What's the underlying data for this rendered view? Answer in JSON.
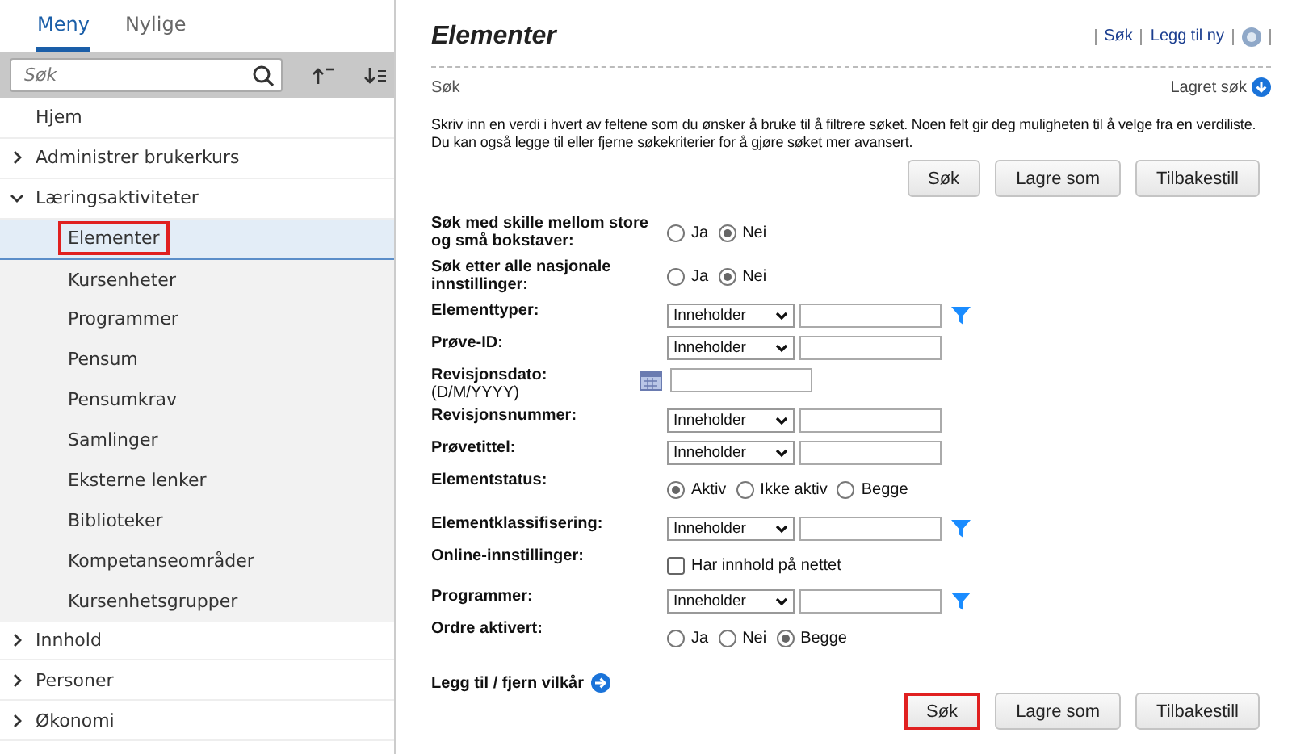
{
  "sidebar": {
    "tabs": [
      {
        "label": "Meny",
        "selected": true
      },
      {
        "label": "Nylige",
        "selected": false
      }
    ],
    "search": {
      "placeholder": "Søk"
    },
    "items": [
      {
        "label": "Hjem",
        "selected": false,
        "marked": false
      },
      {
        "label": "Administrer brukerkurs",
        "expanded": false,
        "selected": false,
        "marked": false
      },
      {
        "label": "Læringsaktiviteter",
        "expanded": true,
        "selected": false,
        "marked": false,
        "children": [
          {
            "label": "Elementer",
            "selected": true,
            "marked": true
          },
          {
            "label": "Kursenheter",
            "selected": false,
            "marked": false
          },
          {
            "label": "Programmer",
            "selected": false,
            "marked": false
          },
          {
            "label": "Pensum",
            "selected": false,
            "marked": false
          },
          {
            "label": "Pensumkrav",
            "selected": false,
            "marked": false
          },
          {
            "label": "Samlinger",
            "selected": false,
            "marked": false
          },
          {
            "label": "Eksterne lenker",
            "selected": false,
            "marked": false
          },
          {
            "label": "Biblioteker",
            "selected": false,
            "marked": false
          },
          {
            "label": "Kompetanseområder",
            "selected": false,
            "marked": false
          },
          {
            "label": "Kursenhetsgrupper",
            "selected": false,
            "marked": false
          }
        ]
      },
      {
        "label": "Innhold",
        "expanded": false,
        "selected": false,
        "marked": false
      },
      {
        "label": "Personer",
        "expanded": false,
        "selected": false,
        "marked": false
      },
      {
        "label": "Økonomi",
        "expanded": false,
        "selected": false,
        "marked": false
      }
    ]
  },
  "main": {
    "title": "Elementer",
    "header_links": [
      "Søk",
      "Legg til ny"
    ],
    "section_label": "Søk",
    "saved_search": "Lagret søk",
    "instructions": [
      "Skriv inn en verdi i hvert av feltene som du ønsker å bruke til å filtrere søket. Noen felt gir deg muligheten til å velge fra en verdiliste.",
      "Du kan også legge til eller fjerne søkekriterier for å gjøre søket mer avansert."
    ],
    "top_buttons": [
      {
        "label": "Søk",
        "marked": false
      },
      {
        "label": "Lagre som",
        "marked": false
      },
      {
        "label": "Tilbakestill",
        "marked": false
      }
    ],
    "fields": [
      {
        "kind": "radio",
        "label": "Søk med skille mellom store og små bokstaver:",
        "options": [
          {
            "label": "Ja",
            "selected": false
          },
          {
            "label": "Nei",
            "selected": true
          }
        ]
      },
      {
        "kind": "radio",
        "label": "Søk etter alle nasjonale innstillinger:",
        "options": [
          {
            "label": "Ja",
            "selected": false
          },
          {
            "label": "Nei",
            "selected": true
          }
        ]
      },
      {
        "kind": "select",
        "label": "Elementtyper:",
        "operator": "Inneholder",
        "filter": true
      },
      {
        "kind": "select",
        "label": "Prøve-ID:",
        "operator": "Inneholder",
        "filter": false
      },
      {
        "kind": "date",
        "label": "Revisjonsdato:",
        "hint": "(D/M/YYYY)"
      },
      {
        "kind": "select",
        "label": "Revisjonsnummer:",
        "operator": "Inneholder",
        "filter": false
      },
      {
        "kind": "select",
        "label": "Prøvetittel:",
        "operator": "Inneholder",
        "filter": false
      },
      {
        "kind": "radio",
        "label": "Elementstatus:",
        "options": [
          {
            "label": "Aktiv",
            "selected": true
          },
          {
            "label": "Ikke aktiv",
            "selected": false
          },
          {
            "label": "Begge",
            "selected": false
          }
        ]
      },
      {
        "kind": "select",
        "label": "Elementklassifisering:",
        "operator": "Inneholder",
        "filter": true
      },
      {
        "kind": "checkbox",
        "label": "Online-innstillinger:",
        "option": "Har innhold på nettet",
        "checked": false
      },
      {
        "kind": "select",
        "label": "Programmer:",
        "operator": "Inneholder",
        "filter": true
      },
      {
        "kind": "radio",
        "label": "Ordre aktivert:",
        "options": [
          {
            "label": "Ja",
            "selected": false
          },
          {
            "label": "Nei",
            "selected": false
          },
          {
            "label": "Begge",
            "selected": true
          }
        ]
      }
    ],
    "add_remove_link": "Legg til / fjern vilkår",
    "bottom_buttons": [
      {
        "label": "Søk",
        "marked": true
      },
      {
        "label": "Lagre som",
        "marked": false
      },
      {
        "label": "Tilbakestill",
        "marked": false
      }
    ]
  }
}
